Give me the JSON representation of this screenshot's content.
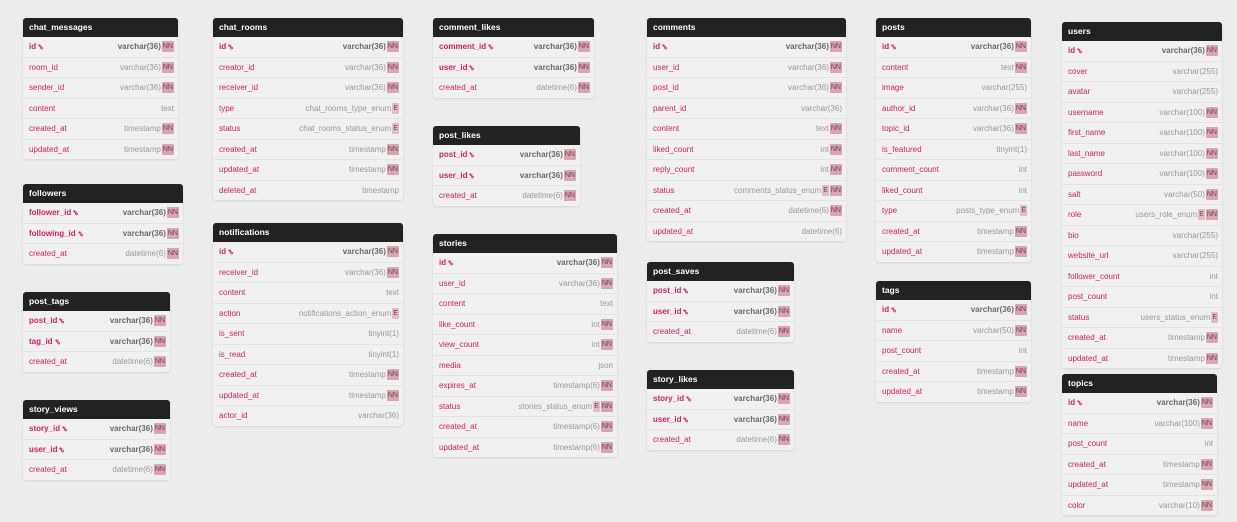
{
  "tables": [
    {
      "name": "chat_messages",
      "columns": [
        {
          "name": "id",
          "type": "varchar(36)",
          "pk": true,
          "nn": true
        },
        {
          "name": "room_id",
          "type": "varchar(36)",
          "nn": true
        },
        {
          "name": "sender_id",
          "type": "varchar(36)",
          "nn": true
        },
        {
          "name": "content",
          "type": "text"
        },
        {
          "name": "created_at",
          "type": "timestamp",
          "nn": true
        },
        {
          "name": "updated_at",
          "type": "timestamp",
          "nn": true
        }
      ]
    },
    {
      "name": "followers",
      "columns": [
        {
          "name": "follower_id",
          "type": "varchar(36)",
          "pk": true,
          "nn": true
        },
        {
          "name": "following_id",
          "type": "varchar(36)",
          "pk": true,
          "nn": true
        },
        {
          "name": "created_at",
          "type": "datetime(6)",
          "nn": true
        }
      ]
    },
    {
      "name": "post_tags",
      "columns": [
        {
          "name": "post_id",
          "type": "varchar(36)",
          "pk": true,
          "nn": true
        },
        {
          "name": "tag_id",
          "type": "varchar(36)",
          "pk": true,
          "nn": true
        },
        {
          "name": "created_at",
          "type": "datetime(6)",
          "nn": true
        }
      ]
    },
    {
      "name": "story_views",
      "columns": [
        {
          "name": "story_id",
          "type": "varchar(36)",
          "pk": true,
          "nn": true
        },
        {
          "name": "user_id",
          "type": "varchar(36)",
          "pk": true,
          "nn": true
        },
        {
          "name": "created_at",
          "type": "datetime(6)",
          "nn": true
        }
      ]
    },
    {
      "name": "chat_rooms",
      "columns": [
        {
          "name": "id",
          "type": "varchar(36)",
          "pk": true,
          "nn": true
        },
        {
          "name": "creator_id",
          "type": "varchar(36)",
          "nn": true
        },
        {
          "name": "receiver_id",
          "type": "varchar(36)",
          "nn": true
        },
        {
          "name": "type",
          "type": "chat_rooms_type_enum",
          "enum": true
        },
        {
          "name": "status",
          "type": "chat_rooms_status_enum",
          "enum": true
        },
        {
          "name": "created_at",
          "type": "timestamp",
          "nn": true
        },
        {
          "name": "updated_at",
          "type": "timestamp",
          "nn": true
        },
        {
          "name": "deleted_at",
          "type": "timestamp"
        }
      ]
    },
    {
      "name": "notifications",
      "columns": [
        {
          "name": "id",
          "type": "varchar(36)",
          "pk": true,
          "nn": true
        },
        {
          "name": "receiver_id",
          "type": "varchar(36)",
          "nn": true
        },
        {
          "name": "content",
          "type": "text"
        },
        {
          "name": "action",
          "type": "notifications_action_enum",
          "enum": true
        },
        {
          "name": "is_sent",
          "type": "tinyint(1)"
        },
        {
          "name": "is_read",
          "type": "tinyint(1)"
        },
        {
          "name": "created_at",
          "type": "timestamp",
          "nn": true
        },
        {
          "name": "updated_at",
          "type": "timestamp",
          "nn": true
        },
        {
          "name": "actor_id",
          "type": "varchar(36)"
        }
      ]
    },
    {
      "name": "comment_likes",
      "columns": [
        {
          "name": "comment_id",
          "type": "varchar(36)",
          "pk": true,
          "nn": true
        },
        {
          "name": "user_id",
          "type": "varchar(36)",
          "pk": true,
          "nn": true
        },
        {
          "name": "created_at",
          "type": "datetime(6)",
          "nn": true
        }
      ]
    },
    {
      "name": "post_likes",
      "columns": [
        {
          "name": "post_id",
          "type": "varchar(36)",
          "pk": true,
          "nn": true
        },
        {
          "name": "user_id",
          "type": "varchar(36)",
          "pk": true,
          "nn": true
        },
        {
          "name": "created_at",
          "type": "datetime(6)",
          "nn": true
        }
      ]
    },
    {
      "name": "stories",
      "columns": [
        {
          "name": "id",
          "type": "varchar(36)",
          "pk": true,
          "nn": true
        },
        {
          "name": "user_id",
          "type": "varchar(36)",
          "nn": true
        },
        {
          "name": "content",
          "type": "text"
        },
        {
          "name": "like_count",
          "type": "int",
          "nn": true
        },
        {
          "name": "view_count",
          "type": "int",
          "nn": true
        },
        {
          "name": "media",
          "type": "json"
        },
        {
          "name": "expires_at",
          "type": "timestamp(6)",
          "nn": true
        },
        {
          "name": "status",
          "type": "stories_status_enum",
          "enum": true,
          "nn": true
        },
        {
          "name": "created_at",
          "type": "timestamp(6)",
          "nn": true
        },
        {
          "name": "updated_at",
          "type": "timestamp(6)",
          "nn": true
        }
      ]
    },
    {
      "name": "comments",
      "columns": [
        {
          "name": "id",
          "type": "varchar(36)",
          "pk": true,
          "nn": true
        },
        {
          "name": "user_id",
          "type": "varchar(36)",
          "nn": true
        },
        {
          "name": "post_id",
          "type": "varchar(36)",
          "nn": true
        },
        {
          "name": "parent_id",
          "type": "varchar(36)"
        },
        {
          "name": "content",
          "type": "text",
          "nn": true
        },
        {
          "name": "liked_count",
          "type": "int",
          "nn": true
        },
        {
          "name": "reply_count",
          "type": "int",
          "nn": true
        },
        {
          "name": "status",
          "type": "comments_status_enum",
          "enum": true,
          "nn": true
        },
        {
          "name": "created_at",
          "type": "datetime(6)",
          "nn": true
        },
        {
          "name": "updated_at",
          "type": "datetime(6)"
        }
      ]
    },
    {
      "name": "post_saves",
      "columns": [
        {
          "name": "post_id",
          "type": "varchar(36)",
          "pk": true,
          "nn": true
        },
        {
          "name": "user_id",
          "type": "varchar(36)",
          "pk": true,
          "nn": true
        },
        {
          "name": "created_at",
          "type": "datetime(6)",
          "nn": true
        }
      ]
    },
    {
      "name": "story_likes",
      "columns": [
        {
          "name": "story_id",
          "type": "varchar(36)",
          "pk": true,
          "nn": true
        },
        {
          "name": "user_id",
          "type": "varchar(36)",
          "pk": true,
          "nn": true
        },
        {
          "name": "created_at",
          "type": "datetime(6)",
          "nn": true
        }
      ]
    },
    {
      "name": "posts",
      "columns": [
        {
          "name": "id",
          "type": "varchar(36)",
          "pk": true,
          "nn": true
        },
        {
          "name": "content",
          "type": "text",
          "nn": true
        },
        {
          "name": "image",
          "type": "varchar(255)"
        },
        {
          "name": "author_id",
          "type": "varchar(36)",
          "nn": true
        },
        {
          "name": "topic_id",
          "type": "varchar(36)",
          "nn": true
        },
        {
          "name": "is_featured",
          "type": "tinyint(1)"
        },
        {
          "name": "comment_count",
          "type": "int"
        },
        {
          "name": "liked_count",
          "type": "int"
        },
        {
          "name": "type",
          "type": "posts_type_enum",
          "enum": true
        },
        {
          "name": "created_at",
          "type": "timestamp",
          "nn": true
        },
        {
          "name": "updated_at",
          "type": "timestamp",
          "nn": true
        }
      ]
    },
    {
      "name": "tags",
      "columns": [
        {
          "name": "id",
          "type": "varchar(36)",
          "pk": true,
          "nn": true
        },
        {
          "name": "name",
          "type": "varchar(50)",
          "nn": true
        },
        {
          "name": "post_count",
          "type": "int"
        },
        {
          "name": "created_at",
          "type": "timestamp",
          "nn": true
        },
        {
          "name": "updated_at",
          "type": "timestamp",
          "nn": true
        }
      ]
    },
    {
      "name": "users",
      "columns": [
        {
          "name": "id",
          "type": "varchar(36)",
          "pk": true,
          "nn": true
        },
        {
          "name": "cover",
          "type": "varchar(255)"
        },
        {
          "name": "avatar",
          "type": "varchar(255)"
        },
        {
          "name": "username",
          "type": "varchar(100)",
          "nn": true
        },
        {
          "name": "first_name",
          "type": "varchar(100)",
          "nn": true
        },
        {
          "name": "last_name",
          "type": "varchar(100)",
          "nn": true
        },
        {
          "name": "password",
          "type": "varchar(100)",
          "nn": true
        },
        {
          "name": "salt",
          "type": "varchar(50)",
          "nn": true
        },
        {
          "name": "role",
          "type": "users_role_enum",
          "enum": true,
          "nn": true
        },
        {
          "name": "bio",
          "type": "varchar(255)"
        },
        {
          "name": "website_url",
          "type": "varchar(255)"
        },
        {
          "name": "follower_count",
          "type": "int"
        },
        {
          "name": "post_count",
          "type": "int"
        },
        {
          "name": "status",
          "type": "users_status_enum",
          "enum": true
        },
        {
          "name": "created_at",
          "type": "timestamp",
          "nn": true
        },
        {
          "name": "updated_at",
          "type": "timestamp",
          "nn": true
        }
      ]
    },
    {
      "name": "topics",
      "columns": [
        {
          "name": "id",
          "type": "varchar(36)",
          "pk": true,
          "nn": true
        },
        {
          "name": "name",
          "type": "varchar(100)",
          "nn": true
        },
        {
          "name": "post_count",
          "type": "int"
        },
        {
          "name": "created_at",
          "type": "timestamp",
          "nn": true
        },
        {
          "name": "updated_at",
          "type": "timestamp",
          "nn": true
        },
        {
          "name": "color",
          "type": "varchar(10)",
          "nn": true
        }
      ]
    }
  ],
  "badges": {
    "not_null": "NN",
    "enum": "E"
  },
  "icons": {
    "primary_key": "key-icon"
  },
  "colors": {
    "header": "#222222",
    "column_name": "#d3245a",
    "type_text": "#9a9a9a",
    "badge": "#d6a6b3",
    "background": "#ececec"
  }
}
